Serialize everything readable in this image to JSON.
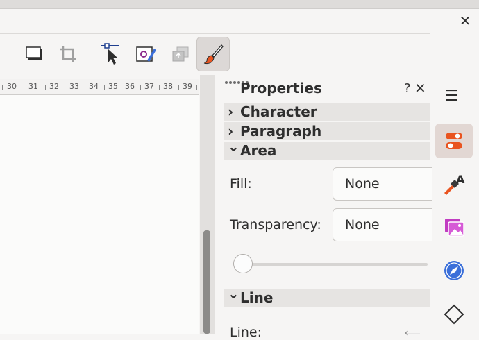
{
  "window": {
    "close_glyph": "✕"
  },
  "toolbar": {
    "buttons": [
      {
        "name": "dropdown-arrow-icon"
      },
      {
        "name": "shadow-icon"
      },
      {
        "name": "crop-icon"
      },
      {
        "name": "select-at-text-icon"
      },
      {
        "name": "image-edit-icon"
      },
      {
        "name": "arrange-icon"
      },
      {
        "name": "paintbrush-icon",
        "active": true
      }
    ]
  },
  "ruler": {
    "ticks": [
      "30",
      "31",
      "32",
      "33",
      "34",
      "35",
      "36",
      "37",
      "38",
      "39"
    ]
  },
  "properties": {
    "title": "Properties",
    "help_glyph": "?",
    "close_glyph": "✕",
    "sections": {
      "character": {
        "label": "Character",
        "chevron": "›"
      },
      "paragraph": {
        "label": "Paragraph",
        "chevron": "›"
      },
      "area": {
        "label": "Area",
        "chevron": "⌄"
      },
      "line": {
        "label": "Line",
        "chevron": "⌄"
      }
    },
    "fill": {
      "label_mnemonic": "F",
      "label_rest": "ill:",
      "value": "None"
    },
    "transparency": {
      "label_mnemonic": "T",
      "label_rest": "ransparency:",
      "value": "None"
    },
    "transparency_slider": {
      "value": 0
    },
    "line": {
      "label": "Line:"
    }
  },
  "sidebar": {
    "items": [
      {
        "name": "sidebar-menu-icon"
      },
      {
        "name": "properties-deck-icon",
        "active": true
      },
      {
        "name": "styles-deck-icon"
      },
      {
        "name": "gallery-deck-icon"
      },
      {
        "name": "navigator-deck-icon"
      },
      {
        "name": "shapes-deck-icon"
      }
    ]
  },
  "colors": {
    "accent_orange": "#e95420",
    "gallery_magenta": "#c13cc1",
    "navigator_blue": "#3b6fd9"
  }
}
